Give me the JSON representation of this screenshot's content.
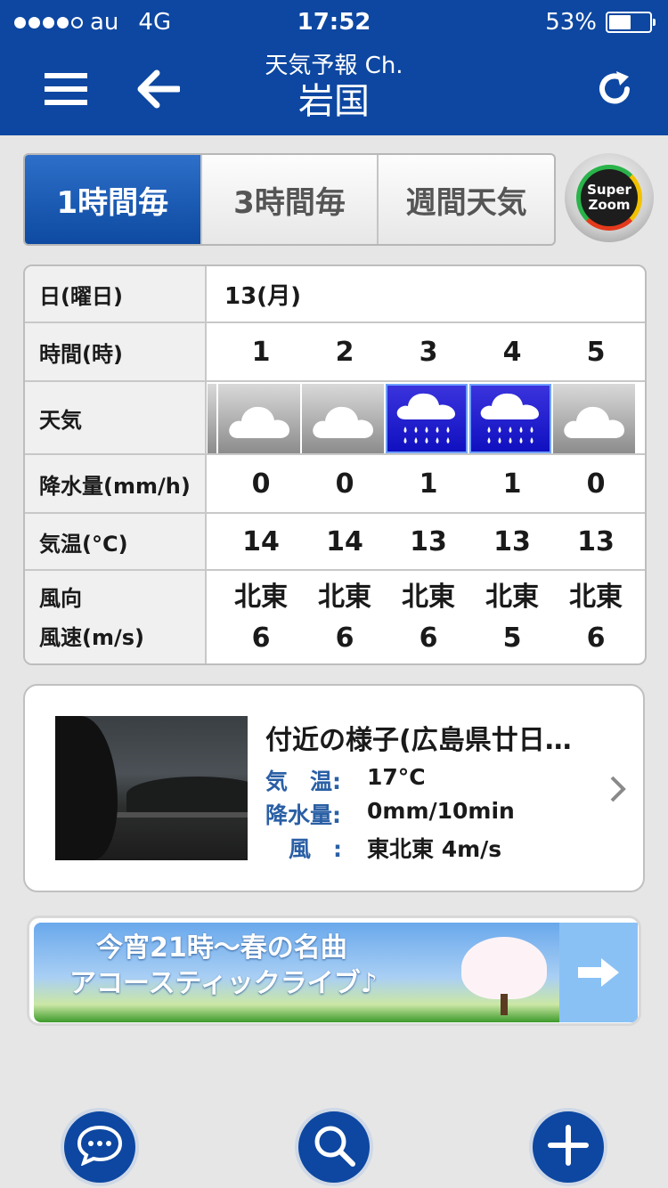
{
  "status_bar": {
    "carrier": "au",
    "network": "4G",
    "time": "17:52",
    "battery": "53%",
    "battery_level": 0.53
  },
  "header": {
    "subtitle": "天気予報 Ch.",
    "title": "岩国",
    "icons": [
      "menu-icon",
      "back-arrow-icon",
      "reload-icon"
    ]
  },
  "tabs": [
    {
      "label": "1時間毎",
      "active": true
    },
    {
      "label": "3時間毎",
      "active": false
    },
    {
      "label": "週間天気",
      "active": false
    }
  ],
  "superzoom": {
    "line1": "Super",
    "line2": "Zoom"
  },
  "forecast_table": {
    "labels": {
      "day": "日(曜日)",
      "hour": "時間(時)",
      "weather": "天気",
      "precip": "降水量(mm/h)",
      "temp": "気温(°C)",
      "wind_dir": "風向",
      "wind_speed": "風速(m/s)"
    },
    "day": "13(月)",
    "hours": [
      "1",
      "2",
      "3",
      "4",
      "5"
    ],
    "weather": [
      "cloudy",
      "cloudy",
      "rain",
      "rain",
      "cloudy"
    ],
    "precip": [
      "0",
      "0",
      "1",
      "1",
      "0"
    ],
    "temp": [
      "14",
      "14",
      "13",
      "13",
      "13"
    ],
    "wind_dir": [
      "北東",
      "北東",
      "北東",
      "北東",
      "北東"
    ],
    "wind_speed": [
      "6",
      "6",
      "6",
      "5",
      "6"
    ]
  },
  "nearby": {
    "title": "付近の様子(広島県廿日…",
    "temp_label": "気　温:",
    "temp_value": "17°C",
    "precip_label": "降水量:",
    "precip_value": "0mm/10min",
    "wind_label": "風　:",
    "wind_value": "東北東 4m/s"
  },
  "banner": {
    "line1": "今宵21時〜春の名曲",
    "line2": "アコースティックライブ♪"
  },
  "bottom_buttons": [
    "chat-icon",
    "search-icon",
    "add-icon"
  ]
}
